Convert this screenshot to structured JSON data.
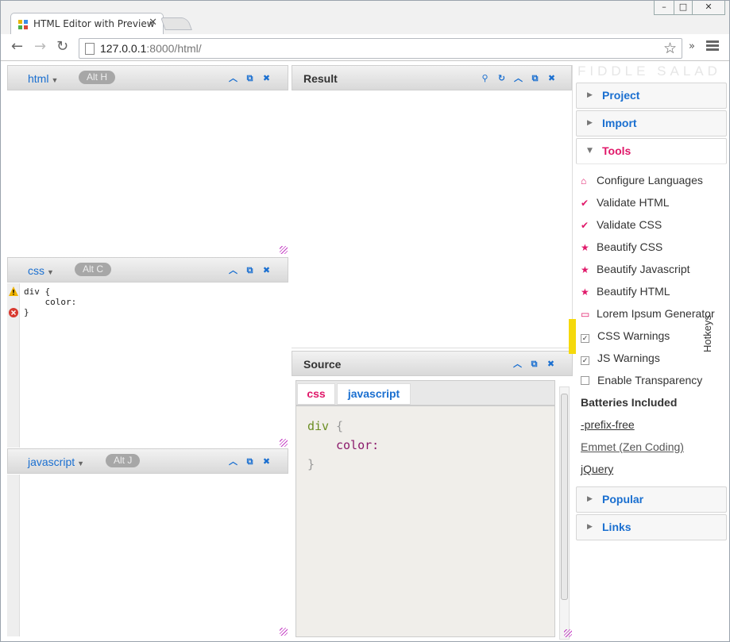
{
  "browser": {
    "tab_title": "HTML Editor with Preview",
    "url_host": "127.0.0.1",
    "url_rest": ":8000/html/",
    "window_buttons": [
      "–",
      "□",
      "✕"
    ]
  },
  "editors": {
    "html": {
      "label": "html",
      "hotkey": "Alt H"
    },
    "css": {
      "label": "css",
      "hotkey": "Alt C",
      "code": "div {\n    color:\n}"
    },
    "javascript": {
      "label": "javascript",
      "hotkey": "Alt J"
    }
  },
  "result": {
    "title": "Result"
  },
  "source": {
    "title": "Source",
    "tabs": [
      "css",
      "javascript"
    ],
    "line1": "div",
    "brace_open": "{",
    "line2": "color:",
    "brace_close": "}"
  },
  "sidebar": {
    "brand": "FIDDLE SALAD",
    "sections": {
      "project": "Project",
      "import": "Import",
      "tools": "Tools",
      "popular": "Popular",
      "links": "Links"
    },
    "tools": [
      "Configure Languages",
      "Validate HTML",
      "Validate CSS",
      "Beautify CSS",
      "Beautify Javascript",
      "Beautify HTML",
      "Lorem Ipsum Generator"
    ],
    "options": [
      {
        "label": "CSS Warnings",
        "checked": true
      },
      {
        "label": "JS Warnings",
        "checked": true
      },
      {
        "label": "Enable Transparency",
        "checked": false
      }
    ],
    "batteries_title": "Batteries Included",
    "batteries": [
      "-prefix-free",
      "Emmet (Zen Coding)",
      "jQuery"
    ],
    "hotkeys_tab": "Hotkeys"
  },
  "colors": {
    "accent": "#1a6fd0",
    "tools_pink": "#e0196a",
    "highlight": "#f5d90c"
  }
}
